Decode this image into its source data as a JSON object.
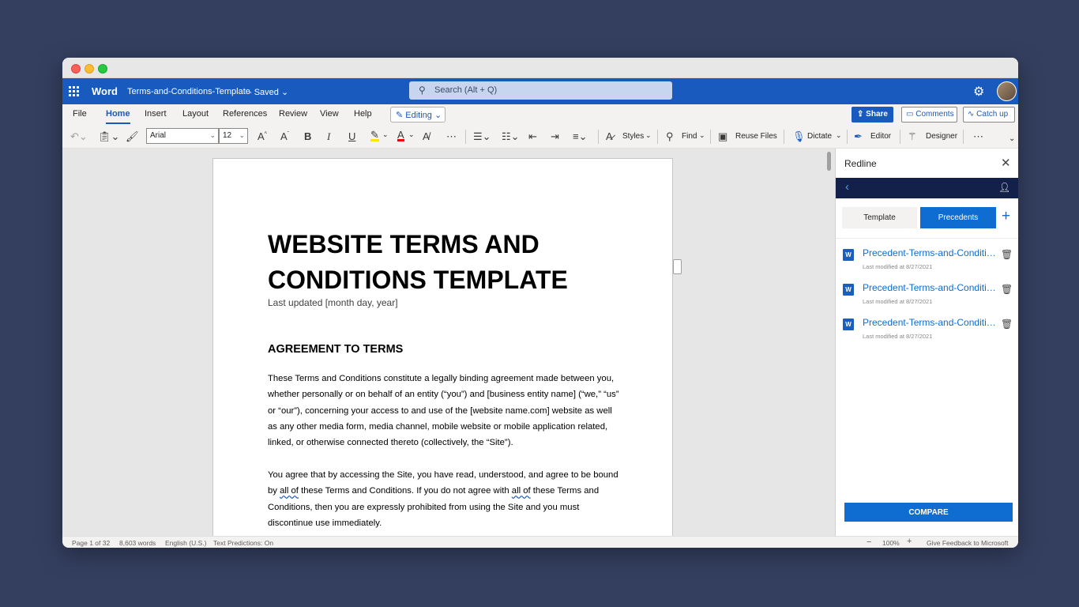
{
  "appbar": {
    "app_name": "Word",
    "doc_name": "Terms-and-Conditions-Template",
    "doc_status": "- Saved ⌄",
    "search_placeholder": "Search (Alt + Q)"
  },
  "tabs": {
    "items": [
      "File",
      "Home",
      "Insert",
      "Layout",
      "References",
      "Review",
      "View",
      "Help"
    ],
    "editing_label": "Editing",
    "share_label": "Share",
    "comments_label": "Comments",
    "catchup_label": "Catch up"
  },
  "ribbon": {
    "font_name": "Arial",
    "font_size": "12",
    "styles_label": "Styles",
    "find_label": "Find",
    "reuse_label": "Reuse Files",
    "dictate_label": "Dictate",
    "editor_label": "Editor",
    "designer_label": "Designer"
  },
  "document": {
    "title": "WEBSITE TERMS AND CONDITIONS TEMPLATE",
    "last_updated": "Last updated [month day, year]",
    "heading": "AGREEMENT TO TERMS",
    "para1": "These Terms and Conditions constitute a legally binding agreement made between you, whether personally or on behalf of an entity (“you”) and [business entity name] (“we,” “us” or “our”), concerning your access to and use of the [website name.com] website as well as any other media form, media channel, mobile website or mobile application related, linked, or otherwise connected thereto (collectively, the “Site”).",
    "para2_a": "You agree that by accessing the Site, you have read, understood, and agree to be bound by ",
    "para2_b": "all of",
    "para2_c": " these Terms and Conditions. If you do not agree with ",
    "para2_d": "all of",
    "para2_e": " these Terms and Conditions, then you are expressly prohibited from using the Site and you must discontinue use immediately."
  },
  "status": {
    "page": "Page 1 of 32",
    "words": "8,603 words",
    "language": "English (U.S.)",
    "predictions": "Text Predictions: On",
    "zoom": "100%",
    "feedback": "Give Feedback to Microsoft"
  },
  "pane": {
    "title": "Redline",
    "template_tab": "Template",
    "precedents_tab": "Precedents",
    "files": [
      {
        "name": "Precedent-Terms-and-Conditions",
        "modified": "Last modified at 8/27/2021"
      },
      {
        "name": "Precedent-Terms-and-Conditions",
        "modified": "Last modified at 8/27/2021"
      },
      {
        "name": "Precedent-Terms-and-Conditions",
        "modified": "Last modified at 8/27/2021"
      }
    ],
    "compare_label": "COMPARE"
  },
  "colors": {
    "background": "#343f5f",
    "word_blue": "#185abd",
    "accent_blue": "#0f6cd1",
    "pane_nav": "#13204a"
  }
}
